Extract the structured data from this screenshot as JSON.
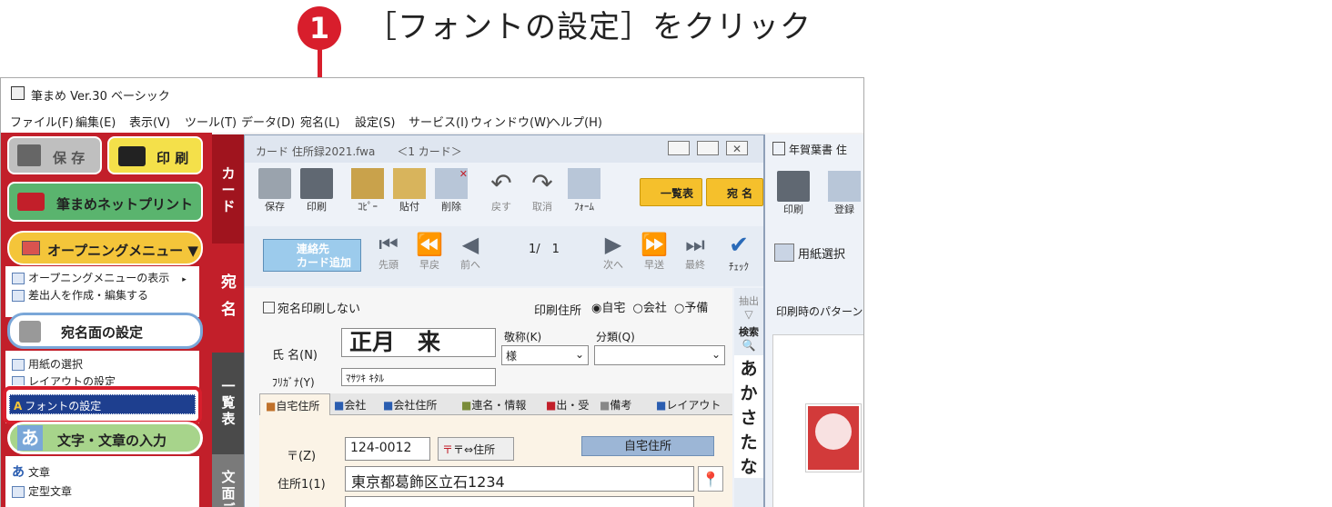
{
  "callout": {
    "number": "1",
    "text": "［フォントの設定］をクリック"
  },
  "window": {
    "title": "筆まめ Ver.30 ベーシック"
  },
  "menu": [
    "ファイル(F)",
    "編集(E)",
    "表示(V)",
    "ツール(T)",
    "データ(D)",
    "宛名(L)",
    "設定(S)",
    "サービス(I)",
    "ウィンドウ(W)",
    "ヘルプ(H)"
  ],
  "left_panel": {
    "save_label": "保 存",
    "print_label": "印 刷",
    "netprint_label": "筆まめネットプリント",
    "opening_menu_label": "オープニングメニュー ▼",
    "items1": [
      "オープニングメニューの表示",
      "差出人を作成・編集する"
    ],
    "address_settings_label": "宛名面の設定",
    "items2": [
      "用紙の選択",
      "レイアウトの設定",
      "フォントの設定"
    ],
    "text_input_label": "文字・文章の入力",
    "items3": [
      "文章",
      "定型文章"
    ],
    "tabs": {
      "card": "カード",
      "atena": "宛名",
      "ichiran": "一覧表",
      "bunmen": "文面デ"
    }
  },
  "card_window": {
    "title": "カード 住所録2021.fwa　　＜1 カード＞",
    "toolbar": [
      "保存",
      "印刷",
      "ｺﾋﾟｰ",
      "貼付",
      "削除",
      "戻す",
      "取消",
      "ﾌｫｰﾑ"
    ],
    "list_btn": "一覧表",
    "atena_btn": "宛 名",
    "add_card": "連絡先\nカード追加",
    "nav_labels": [
      "先頭",
      "早戻",
      "前へ",
      "次へ",
      "早送",
      "最終"
    ],
    "page_counter": "1/　1",
    "check_label": "ﾁｪｯｸ",
    "no_print_label": "宛名印刷しない",
    "print_address_label": "印刷住所",
    "address_options": [
      "自宅",
      "会社",
      "予備"
    ],
    "name_label": "氏 名(N)",
    "name_value": "正月　来",
    "furigana_label": "ﾌﾘｶﾞﾅ(Y)",
    "furigana_value": "ﾏｻﾂｷ ｷﾀﾙ",
    "honorific_label": "敬称(K)",
    "honorific_value": "様",
    "category_label": "分類(Q)",
    "tabs": [
      "自宅住所",
      "会社",
      "会社住所",
      "連名・情報",
      "出・受",
      "備考",
      "レイアウト"
    ],
    "postal_label": "〒(Z)",
    "postal_value": "124-0012",
    "postal_btn": "〒⇔住所",
    "home_address_btn": "自宅住所",
    "address1_label": "住所1(1)",
    "address1_value": "東京都葛飾区立石1234",
    "search_label": "検索",
    "extract_label": "抽出",
    "kana_index": [
      "あ",
      "か",
      "さ",
      "た",
      "な"
    ]
  },
  "right_window": {
    "title": "年賀葉書 住",
    "print": "印刷",
    "register": "登録",
    "paper_select": "用紙選択",
    "pattern": "印刷時のパターン"
  },
  "colors": {
    "callout_red": "#d81e2c",
    "panel_red": "#c21f2a",
    "highlight_blue": "#1e3f8f"
  }
}
